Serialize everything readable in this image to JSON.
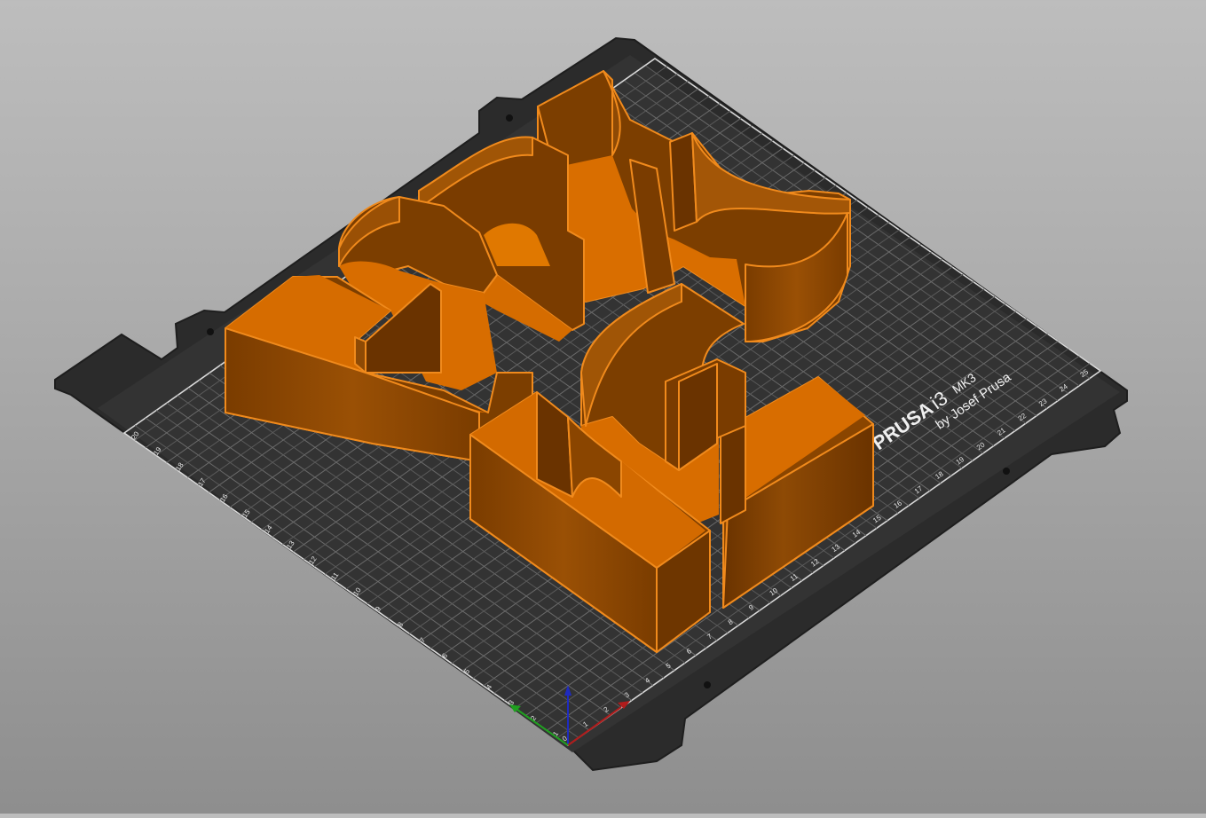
{
  "viewport": {
    "bed_label": {
      "brand": "PRUSA",
      "model": "i3",
      "variant": "MK3",
      "credit": "by Josef Prusa"
    },
    "bed_ticks_left": [
      "20",
      "19",
      "18",
      "17",
      "16",
      "15",
      "14",
      "13",
      "12",
      "11",
      "10",
      "9",
      "8",
      "7",
      "6",
      "5",
      "4",
      "3",
      "2",
      "1"
    ],
    "bed_ticks_right": [
      "0",
      "1",
      "2",
      "3",
      "4",
      "5",
      "6",
      "7",
      "8",
      "9",
      "10",
      "11",
      "12",
      "13",
      "14",
      "15",
      "16",
      "17",
      "18",
      "19",
      "20",
      "21",
      "22",
      "23",
      "24",
      "25"
    ],
    "colors": {
      "bed": "#2d2d2d",
      "object_light": "#e07b12",
      "object_side": "#8a4500",
      "object_dark": "#6e3600",
      "object_floor": "#d86d00",
      "axis_x": "#c02020",
      "axis_y": "#20a020",
      "axis_z": "#2020c0"
    },
    "icons": [
      "axis-gizmo-icon"
    ]
  }
}
